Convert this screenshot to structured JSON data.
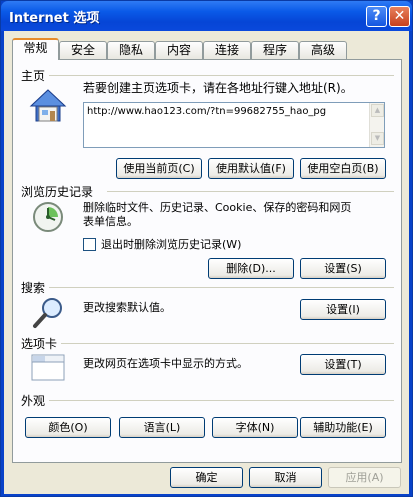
{
  "window": {
    "title": "Internet 选项"
  },
  "titlebar": {
    "help": "?",
    "close": "✕"
  },
  "tabs": [
    "常规",
    "安全",
    "隐私",
    "内容",
    "连接",
    "程序",
    "高级"
  ],
  "homepage": {
    "title": "主页",
    "desc": "若要创建主页选项卡，请在各地址行键入地址(R)。",
    "url": "http://www.hao123.com/?tn=99682755_hao_pg",
    "buttons": {
      "current": "使用当前页(C)",
      "default": "使用默认值(F)",
      "blank": "使用空白页(B)"
    }
  },
  "history": {
    "title": "浏览历史记录",
    "desc_line1": "删除临时文件、历史记录、Cookie、保存的密码和网页",
    "desc_line2": "表单信息。",
    "checkbox": "退出时删除浏览历史记录(W)",
    "checked": false,
    "delete_button": "删除(D)...",
    "settings_button": "设置(S)"
  },
  "search": {
    "title": "搜索",
    "desc": "更改搜索默认值。",
    "settings_button": "设置(I)"
  },
  "tabsection": {
    "title": "选项卡",
    "desc": "更改网页在选项卡中显示的方式。",
    "settings_button": "设置(T)"
  },
  "appearance": {
    "title": "外观",
    "colors": "颜色(O)",
    "languages": "语言(L)",
    "fonts": "字体(N)",
    "accessibility": "辅助功能(E)"
  },
  "footer": {
    "ok": "确定",
    "cancel": "取消",
    "apply": "应用(A)"
  },
  "icons": [
    "house-icon",
    "history-clock-icon",
    "magnifier-icon",
    "tabs-window-icon",
    "checkbox",
    "scroll-up-icon",
    "scroll-down-icon"
  ]
}
